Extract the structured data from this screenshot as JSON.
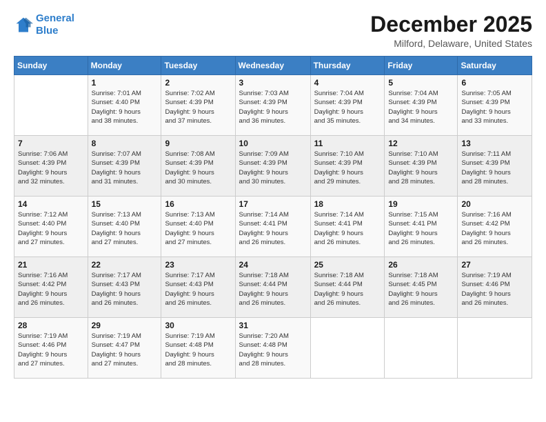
{
  "header": {
    "logo_line1": "General",
    "logo_line2": "Blue",
    "title": "December 2025",
    "subtitle": "Milford, Delaware, United States"
  },
  "calendar": {
    "days_of_week": [
      "Sunday",
      "Monday",
      "Tuesday",
      "Wednesday",
      "Thursday",
      "Friday",
      "Saturday"
    ],
    "weeks": [
      [
        {
          "day": "",
          "info": ""
        },
        {
          "day": "1",
          "info": "Sunrise: 7:01 AM\nSunset: 4:40 PM\nDaylight: 9 hours\nand 38 minutes."
        },
        {
          "day": "2",
          "info": "Sunrise: 7:02 AM\nSunset: 4:39 PM\nDaylight: 9 hours\nand 37 minutes."
        },
        {
          "day": "3",
          "info": "Sunrise: 7:03 AM\nSunset: 4:39 PM\nDaylight: 9 hours\nand 36 minutes."
        },
        {
          "day": "4",
          "info": "Sunrise: 7:04 AM\nSunset: 4:39 PM\nDaylight: 9 hours\nand 35 minutes."
        },
        {
          "day": "5",
          "info": "Sunrise: 7:04 AM\nSunset: 4:39 PM\nDaylight: 9 hours\nand 34 minutes."
        },
        {
          "day": "6",
          "info": "Sunrise: 7:05 AM\nSunset: 4:39 PM\nDaylight: 9 hours\nand 33 minutes."
        }
      ],
      [
        {
          "day": "7",
          "info": "Sunrise: 7:06 AM\nSunset: 4:39 PM\nDaylight: 9 hours\nand 32 minutes."
        },
        {
          "day": "8",
          "info": "Sunrise: 7:07 AM\nSunset: 4:39 PM\nDaylight: 9 hours\nand 31 minutes."
        },
        {
          "day": "9",
          "info": "Sunrise: 7:08 AM\nSunset: 4:39 PM\nDaylight: 9 hours\nand 30 minutes."
        },
        {
          "day": "10",
          "info": "Sunrise: 7:09 AM\nSunset: 4:39 PM\nDaylight: 9 hours\nand 30 minutes."
        },
        {
          "day": "11",
          "info": "Sunrise: 7:10 AM\nSunset: 4:39 PM\nDaylight: 9 hours\nand 29 minutes."
        },
        {
          "day": "12",
          "info": "Sunrise: 7:10 AM\nSunset: 4:39 PM\nDaylight: 9 hours\nand 28 minutes."
        },
        {
          "day": "13",
          "info": "Sunrise: 7:11 AM\nSunset: 4:39 PM\nDaylight: 9 hours\nand 28 minutes."
        }
      ],
      [
        {
          "day": "14",
          "info": "Sunrise: 7:12 AM\nSunset: 4:40 PM\nDaylight: 9 hours\nand 27 minutes."
        },
        {
          "day": "15",
          "info": "Sunrise: 7:13 AM\nSunset: 4:40 PM\nDaylight: 9 hours\nand 27 minutes."
        },
        {
          "day": "16",
          "info": "Sunrise: 7:13 AM\nSunset: 4:40 PM\nDaylight: 9 hours\nand 27 minutes."
        },
        {
          "day": "17",
          "info": "Sunrise: 7:14 AM\nSunset: 4:41 PM\nDaylight: 9 hours\nand 26 minutes."
        },
        {
          "day": "18",
          "info": "Sunrise: 7:14 AM\nSunset: 4:41 PM\nDaylight: 9 hours\nand 26 minutes."
        },
        {
          "day": "19",
          "info": "Sunrise: 7:15 AM\nSunset: 4:41 PM\nDaylight: 9 hours\nand 26 minutes."
        },
        {
          "day": "20",
          "info": "Sunrise: 7:16 AM\nSunset: 4:42 PM\nDaylight: 9 hours\nand 26 minutes."
        }
      ],
      [
        {
          "day": "21",
          "info": "Sunrise: 7:16 AM\nSunset: 4:42 PM\nDaylight: 9 hours\nand 26 minutes."
        },
        {
          "day": "22",
          "info": "Sunrise: 7:17 AM\nSunset: 4:43 PM\nDaylight: 9 hours\nand 26 minutes."
        },
        {
          "day": "23",
          "info": "Sunrise: 7:17 AM\nSunset: 4:43 PM\nDaylight: 9 hours\nand 26 minutes."
        },
        {
          "day": "24",
          "info": "Sunrise: 7:18 AM\nSunset: 4:44 PM\nDaylight: 9 hours\nand 26 minutes."
        },
        {
          "day": "25",
          "info": "Sunrise: 7:18 AM\nSunset: 4:44 PM\nDaylight: 9 hours\nand 26 minutes."
        },
        {
          "day": "26",
          "info": "Sunrise: 7:18 AM\nSunset: 4:45 PM\nDaylight: 9 hours\nand 26 minutes."
        },
        {
          "day": "27",
          "info": "Sunrise: 7:19 AM\nSunset: 4:46 PM\nDaylight: 9 hours\nand 26 minutes."
        }
      ],
      [
        {
          "day": "28",
          "info": "Sunrise: 7:19 AM\nSunset: 4:46 PM\nDaylight: 9 hours\nand 27 minutes."
        },
        {
          "day": "29",
          "info": "Sunrise: 7:19 AM\nSunset: 4:47 PM\nDaylight: 9 hours\nand 27 minutes."
        },
        {
          "day": "30",
          "info": "Sunrise: 7:19 AM\nSunset: 4:48 PM\nDaylight: 9 hours\nand 28 minutes."
        },
        {
          "day": "31",
          "info": "Sunrise: 7:20 AM\nSunset: 4:48 PM\nDaylight: 9 hours\nand 28 minutes."
        },
        {
          "day": "",
          "info": ""
        },
        {
          "day": "",
          "info": ""
        },
        {
          "day": "",
          "info": ""
        }
      ]
    ]
  }
}
